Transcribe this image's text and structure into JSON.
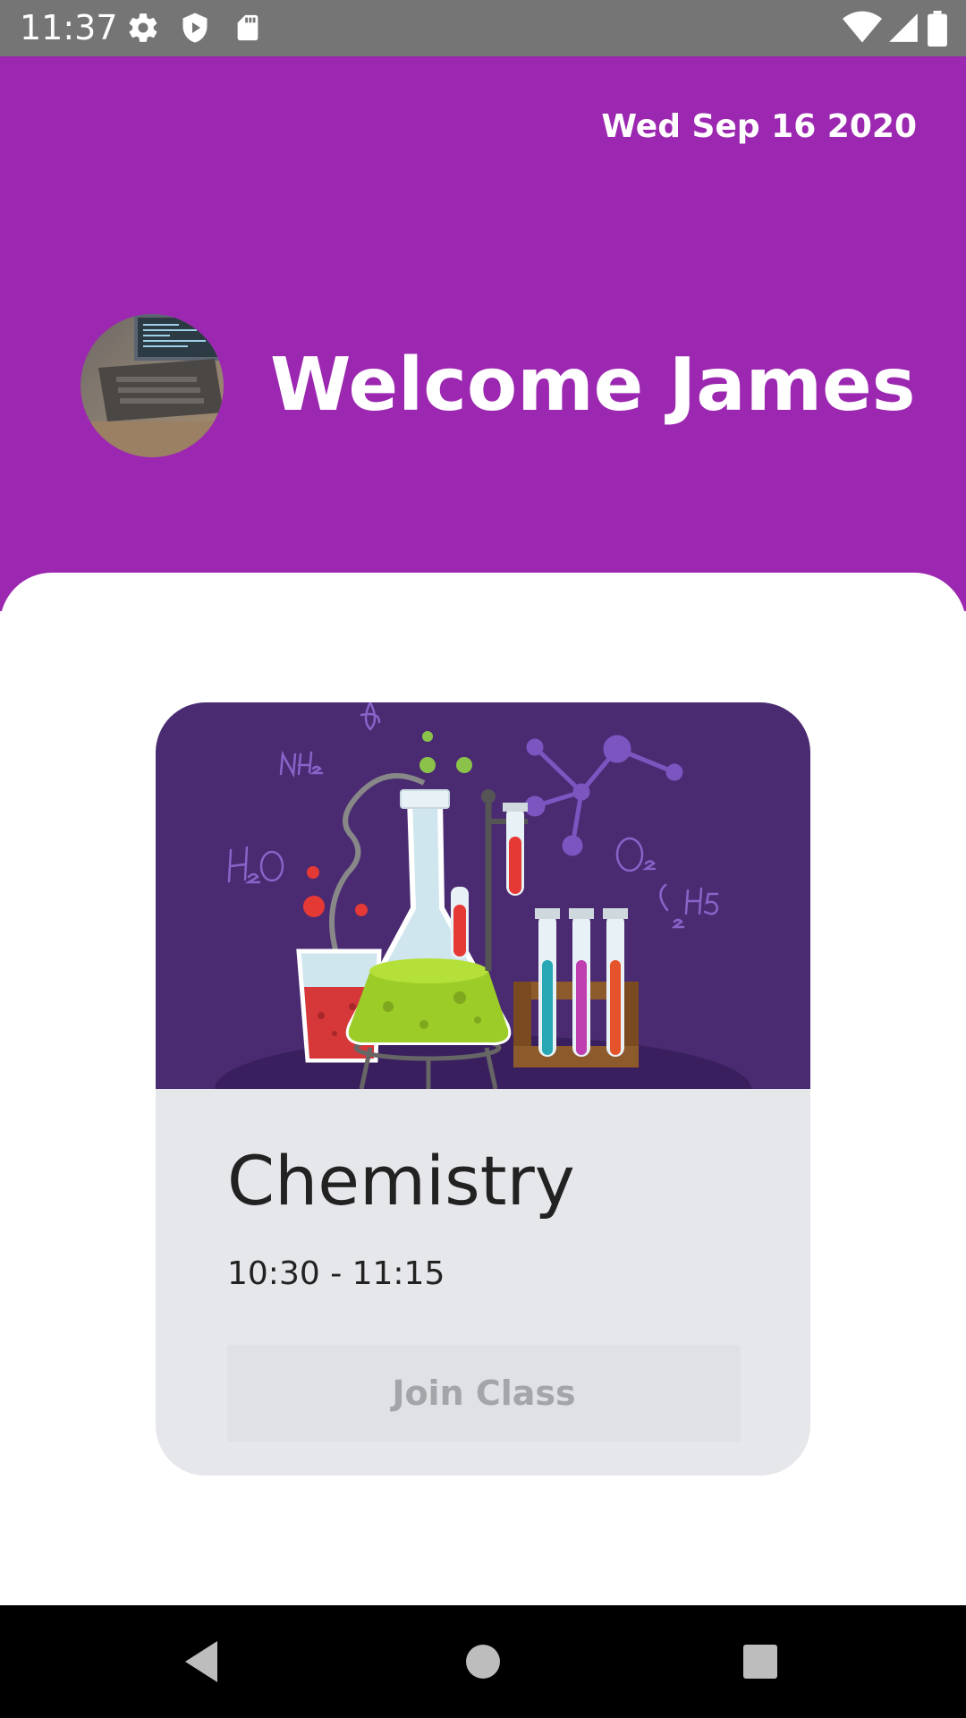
{
  "status_bar": {
    "time": "11:37",
    "icons": [
      "settings-icon",
      "shield-icon",
      "sd-card-icon",
      "wifi-icon",
      "signal-icon",
      "battery-icon"
    ]
  },
  "header": {
    "date": "Wed Sep 16 2020",
    "welcome": "Welcome James",
    "avatar": "avatar-photo",
    "background_color": "#9c27b0"
  },
  "class_card": {
    "image": "chemistry-illustration",
    "name": "Chemistry",
    "time": "10:30 - 11:15",
    "join_label": "Join Class",
    "join_enabled": false
  },
  "nav_bar": {
    "buttons": [
      "back-icon",
      "home-icon",
      "recents-icon"
    ]
  }
}
